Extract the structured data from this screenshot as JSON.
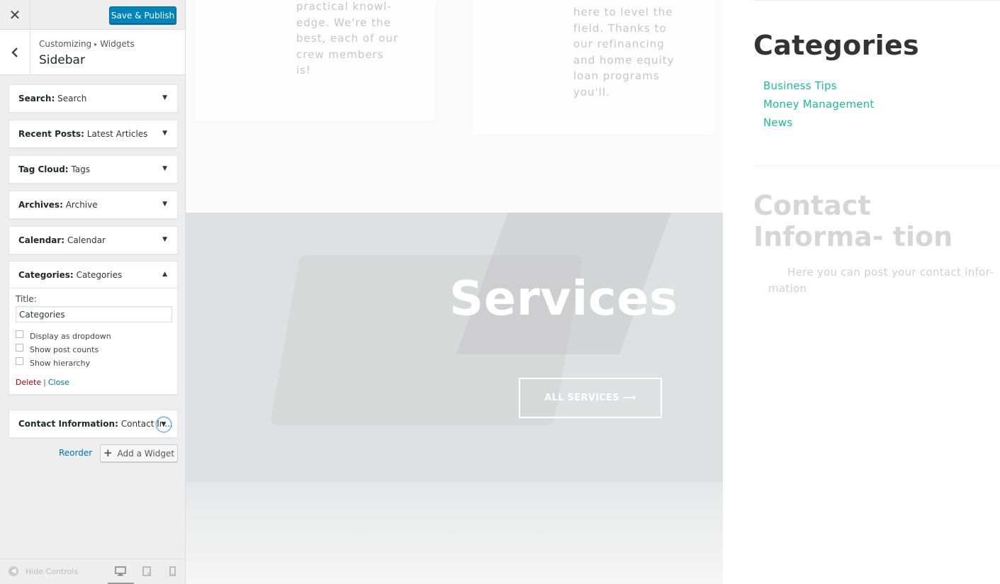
{
  "header": {
    "close_icon": "close-icon",
    "publish_label": "Save & Publish",
    "publish_color": "#0085ba"
  },
  "section": {
    "breadcrumb_root": "Customizing",
    "breadcrumb_child": "Widgets",
    "title": "Sidebar",
    "back_icon": "chevron-left-icon"
  },
  "widgets": [
    {
      "type": "Search:",
      "title": "Search"
    },
    {
      "type": "Recent Posts:",
      "title": "Latest Articles"
    },
    {
      "type": "Tag Cloud:",
      "title": "Tags"
    },
    {
      "type": "Archives:",
      "title": "Archive"
    },
    {
      "type": "Calendar:",
      "title": "Calendar"
    },
    {
      "type": "Categories:",
      "title": "Categories"
    },
    {
      "type": "Contact Information:",
      "title": "Contact In..."
    }
  ],
  "categories_form": {
    "title_label": "Title:",
    "title_value": "Categories",
    "checkboxes": [
      {
        "label": "Display as dropdown",
        "checked": false
      },
      {
        "label": "Show post counts",
        "checked": false
      },
      {
        "label": "Show hierarchy",
        "checked": false
      }
    ],
    "delete_label": "Delete",
    "separator": "|",
    "close_label": "Close"
  },
  "actions": {
    "reorder_label": "Reorder",
    "add_widget_label": "Add a Widget"
  },
  "footer": {
    "hide_controls_label": "Hide Controls",
    "devices": [
      "desktop-icon",
      "tablet-icon",
      "mobile-icon"
    ],
    "active_device": "desktop"
  },
  "preview": {
    "card1_text": [
      "practical knowl-",
      "edge. We're the",
      "best, each of our",
      "crew members",
      "is!"
    ],
    "card2_text": [
      "here to level the",
      "field. Thanks to",
      "our refinancing",
      "and home equity",
      "loan programs",
      "you'll."
    ],
    "services_title": "Services",
    "services_button": "ALL SERVICES ⟶",
    "categories_heading": "Categories",
    "category_links": [
      "Business Tips",
      "Money Management",
      "News"
    ],
    "link_color": "#1abc9c",
    "contact_heading": "Contact Informa- tion",
    "contact_text": "Here you can post your contact infor- mation"
  }
}
